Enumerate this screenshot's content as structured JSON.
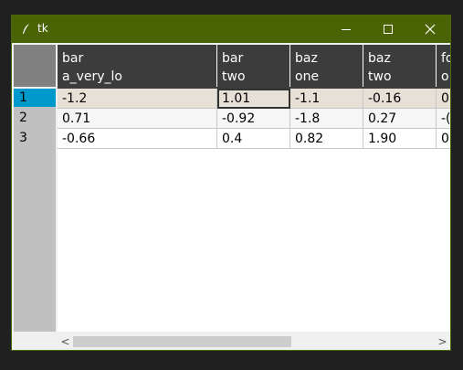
{
  "window": {
    "title": "tk"
  },
  "colors": {
    "titlebar": "#4a6304",
    "header_bg": "#3c3c3c",
    "row_selected": "#e7e0d6",
    "index_selected": "#0099cc"
  },
  "table": {
    "columns": [
      {
        "top": "bar",
        "bottom": "a_very_lo"
      },
      {
        "top": "bar",
        "bottom": "two"
      },
      {
        "top": "baz",
        "bottom": "one"
      },
      {
        "top": "baz",
        "bottom": "two"
      },
      {
        "top": "fo",
        "bottom": "o"
      }
    ],
    "row_labels": [
      "1",
      "2",
      "3"
    ],
    "rows": [
      [
        "-1.2",
        "1.01",
        "-1.1",
        "-0.16",
        "0"
      ],
      [
        "0.71",
        "-0.92",
        "-1.8",
        "0.27",
        "-("
      ],
      [
        "-0.66",
        "0.4",
        "0.82",
        "1.90",
        "0"
      ]
    ],
    "selected_row": 0,
    "active_cell": [
      0,
      1
    ]
  },
  "scrollbar": {
    "left_arrow": "<",
    "right_arrow": ">"
  },
  "icons": {
    "app": "feather-icon",
    "minimize": "minimize-icon",
    "maximize": "maximize-icon",
    "close": "close-icon"
  }
}
